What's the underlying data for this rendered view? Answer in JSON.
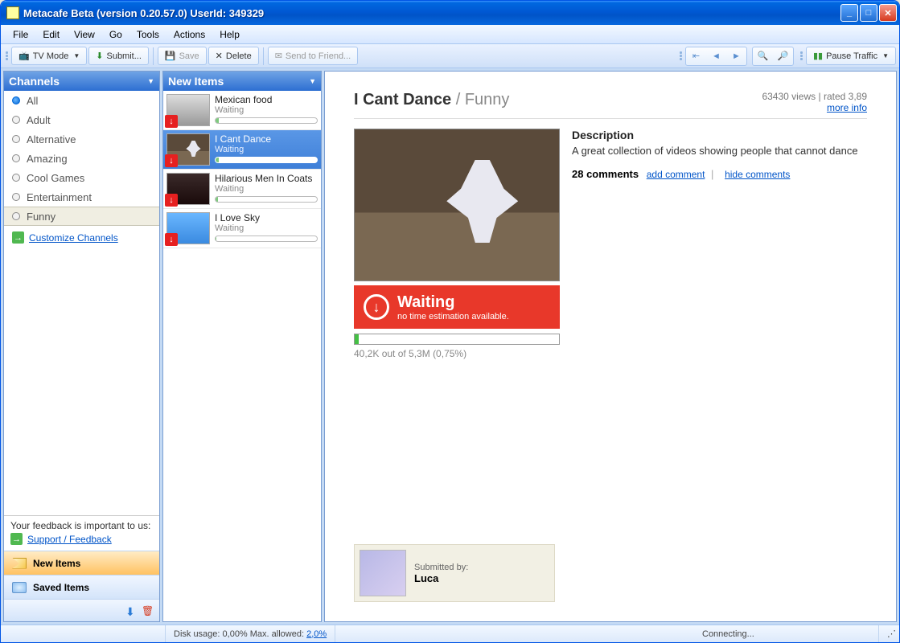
{
  "window": {
    "title": "Metacafe Beta (version 0.20.57.0) UserId: 349329"
  },
  "menubar": [
    "File",
    "Edit",
    "View",
    "Go",
    "Tools",
    "Actions",
    "Help"
  ],
  "toolbar": {
    "tv": "TV Mode",
    "submit": "Submit...",
    "save": "Save",
    "delete": "Delete",
    "send": "Send to Friend...",
    "pause": "Pause Traffic"
  },
  "channels": {
    "title": "Channels",
    "items": [
      {
        "label": "All",
        "on": true
      },
      {
        "label": "Adult",
        "on": false
      },
      {
        "label": "Alternative",
        "on": false
      },
      {
        "label": "Amazing",
        "on": false
      },
      {
        "label": "Cool Games",
        "on": false
      },
      {
        "label": "Entertainment",
        "on": false
      },
      {
        "label": "Funny",
        "on": false,
        "selected": true
      }
    ],
    "customize": "Customize Channels",
    "feedback_prompt": "Your feedback is important to us:",
    "feedback_link": "Support / Feedback",
    "new_items": "New Items",
    "saved_items": "Saved Items"
  },
  "newItems": {
    "title": "New Items",
    "list": [
      {
        "title": "Mexican food",
        "status": "Waiting",
        "prog": 3
      },
      {
        "title": "I Cant Dance",
        "status": "Waiting",
        "prog": 3,
        "selected": true
      },
      {
        "title": "Hilarious Men In Coats",
        "status": "Waiting",
        "prog": 2
      },
      {
        "title": "I Love Sky",
        "status": "Waiting",
        "prog": 1
      }
    ]
  },
  "detail": {
    "title": "I Cant Dance",
    "channel": "Funny",
    "views": "63430 views",
    "rated": "rated 3,89",
    "more_info": "more info",
    "desc_h": "Description",
    "desc": "A great collection of videos showing people that cannot dance",
    "comments_count": "28 comments",
    "add_comment": "add comment",
    "hide_comments": "hide comments",
    "status_h": "Waiting",
    "status_s": "no time estimation available.",
    "prog_text": "40,2K out of 5,3M (0,75%)",
    "submitted_by": "Submitted by:",
    "submitter": "Luca"
  },
  "statusbar": {
    "disk": "Disk usage: 0,00%  Max. allowed:",
    "disk_link": "2,0%",
    "connecting": "Connecting..."
  }
}
